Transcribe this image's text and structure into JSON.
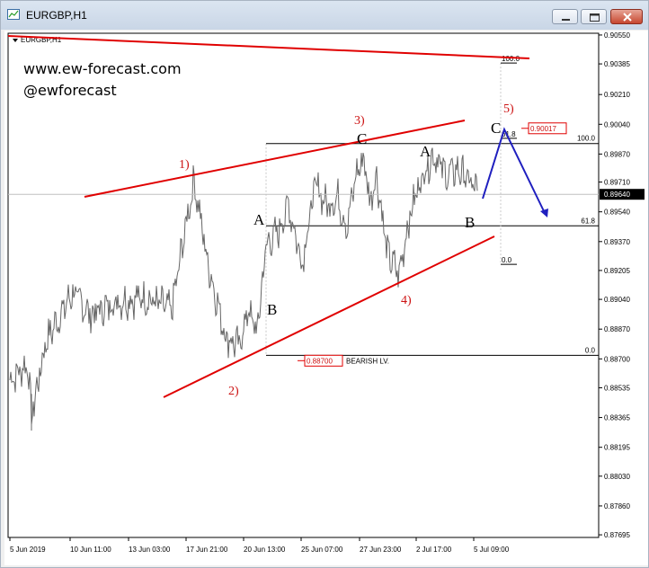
{
  "window": {
    "title": "EURGBP,H1"
  },
  "watermark": {
    "site": "www.ew-forecast.com",
    "handle": "@ewforecast"
  },
  "chart_data": {
    "type": "line",
    "symbol_label": "EURGBP,H1",
    "price_axis": {
      "min": 0.8768,
      "max": 0.9056,
      "ticks": [
        0.9055,
        0.90385,
        0.9021,
        0.9004,
        0.8987,
        0.8971,
        0.8954,
        0.8937,
        0.89205,
        0.8904,
        0.8887,
        0.887,
        0.88535,
        0.88365,
        0.88195,
        0.8803,
        0.8786,
        0.87695
      ],
      "tick_labels": [
        "0.90550",
        "0.90385",
        "0.90210",
        "0.90040",
        "0.89870",
        "0.89710",
        "0.89540",
        "0.89370",
        "0.89205",
        "0.89040",
        "0.88870",
        "0.88700",
        "0.88535",
        "0.88365",
        "0.88195",
        "0.88030",
        "0.87860",
        "0.87695"
      ],
      "current_price": 0.8964,
      "current_price_label": "0.89640"
    },
    "time_axis": {
      "tick_labels": [
        "5 Jun 2019",
        "10 Jun 11:00",
        "13 Jun 03:00",
        "17 Jun 21:00",
        "20 Jun 13:00",
        "25 Jun 07:00",
        "27 Jun 23:00",
        "2 Jul 17:00",
        "5 Jul 09:00"
      ],
      "tick_index": [
        0,
        67,
        132,
        196,
        260,
        324,
        389,
        452,
        516
      ]
    },
    "price_path": {
      "anchor_index": [
        0,
        20,
        24,
        40,
        70,
        90,
        120,
        150,
        180,
        197,
        205,
        220,
        240,
        255,
        265,
        275,
        285,
        298,
        310,
        325,
        340,
        352,
        365,
        375,
        385,
        394,
        400,
        408,
        420,
        433,
        442,
        452,
        462,
        472,
        485,
        500,
        513,
        520
      ],
      "anchor_price": [
        0.8858,
        0.8867,
        0.8837,
        0.888,
        0.8908,
        0.8895,
        0.8903,
        0.8905,
        0.8898,
        0.895,
        0.8972,
        0.8925,
        0.8883,
        0.8877,
        0.8898,
        0.8885,
        0.8935,
        0.8942,
        0.8958,
        0.8925,
        0.897,
        0.8958,
        0.8962,
        0.8945,
        0.8975,
        0.8985,
        0.896,
        0.8975,
        0.893,
        0.8918,
        0.8945,
        0.8965,
        0.8978,
        0.8987,
        0.8975,
        0.8978,
        0.897,
        0.8966
      ]
    },
    "fib_levels": [
      {
        "label": "100.0",
        "price": 0.8993
      },
      {
        "label": "61.8",
        "price": 0.8946
      },
      {
        "label": "0.0",
        "price": 0.8872
      }
    ],
    "projection_fib": [
      {
        "label": "100.0",
        "price": 0.9039
      },
      {
        "label": "61.8",
        "price": 0.8996
      },
      {
        "label": "0.0",
        "price": 0.8924
      }
    ],
    "red_wave_labels": [
      "1)",
      "2)",
      "3)",
      "4)",
      "5)"
    ],
    "black_wave_labels": [
      "A",
      "B",
      "C",
      "A",
      "B",
      "C"
    ],
    "bearish_level": {
      "price_label": "0.88700",
      "text": "BEARISH LV."
    },
    "target_level": {
      "price_label": "0.90017"
    },
    "colors": {
      "price_line": "#666666",
      "trendlines": "#e00000",
      "projection": "#1f1fbf",
      "price_tag_bg": "#000000"
    }
  }
}
